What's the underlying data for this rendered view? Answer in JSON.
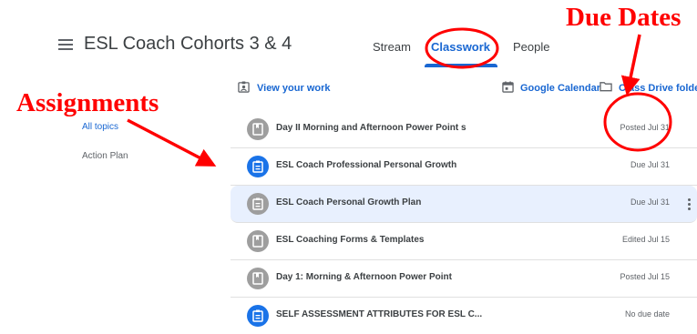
{
  "header": {
    "course_title": "ESL Coach Cohorts 3 & 4",
    "tabs": [
      {
        "label": "Stream"
      },
      {
        "label": "Classwork"
      },
      {
        "label": "People"
      }
    ],
    "active_tab": "Classwork"
  },
  "toolbar": {
    "view_work_label": "View your work",
    "calendar_label": "Google Calendar",
    "drive_label": "Class Drive folder"
  },
  "topics": [
    {
      "label": "All topics"
    },
    {
      "label": "Action Plan"
    }
  ],
  "items": [
    {
      "title": "Day II Morning and Afternoon Power Point s",
      "status": "Posted Jul 31",
      "type": "material",
      "icon": "book-icon"
    },
    {
      "title": "ESL Coach Professional Personal Growth",
      "status": "Due Jul 31",
      "type": "assignment",
      "icon": "assignment-icon"
    },
    {
      "title": "ESL Coach Personal Growth Plan",
      "status": "Due Jul 31",
      "type": "assignment",
      "icon": "assignment-icon"
    },
    {
      "title": "ESL Coaching Forms & Templates",
      "status": "Edited Jul 15",
      "type": "material",
      "icon": "book-icon"
    },
    {
      "title": "Day 1: Morning & Afternoon Power Point",
      "status": "Posted Jul 15",
      "type": "material",
      "icon": "book-icon"
    },
    {
      "title": "SELF ASSESSMENT ATTRIBUTES FOR ESL C...",
      "status": "No due date",
      "type": "assignment",
      "icon": "assignment-icon"
    }
  ],
  "annotations": {
    "due_dates": "Due Dates",
    "assignments": "Assignments"
  },
  "colors": {
    "accent": "#1967d2",
    "annotation": "#ff0000",
    "material_icon_bg": "#9e9e9e",
    "assignment_icon_bg": "#1a73e8",
    "highlight_row": "#e8f0fe"
  }
}
